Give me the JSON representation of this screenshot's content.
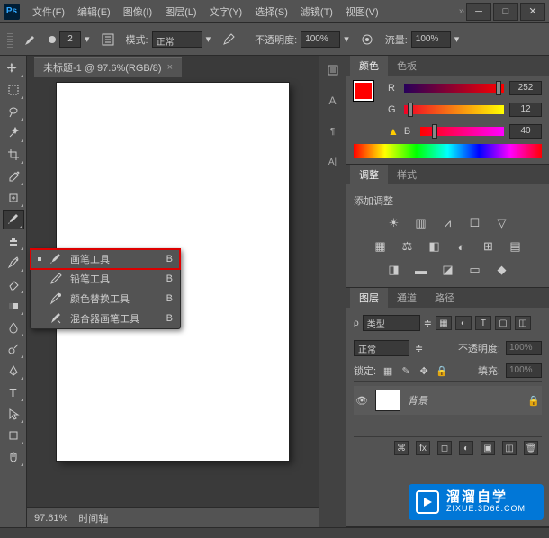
{
  "titlebar": {
    "menus": [
      "文件(F)",
      "编辑(E)",
      "图像(I)",
      "图层(L)",
      "文字(Y)",
      "选择(S)",
      "滤镜(T)",
      "视图(V)"
    ]
  },
  "options": {
    "brush_size": "2",
    "mode_label": "模式:",
    "mode_value": "正常",
    "opacity_label": "不透明度:",
    "opacity_value": "100%",
    "flow_label": "流量:",
    "flow_value": "100%"
  },
  "document": {
    "tab_title": "未标题-1 @ 97.6%(RGB/8)",
    "zoom": "97.61%",
    "timeline": "时间轴"
  },
  "flyout": {
    "items": [
      {
        "label": "画笔工具",
        "shortcut": "B",
        "active": true
      },
      {
        "label": "铅笔工具",
        "shortcut": "B",
        "active": false
      },
      {
        "label": "颜色替换工具",
        "shortcut": "B",
        "active": false
      },
      {
        "label": "混合器画笔工具",
        "shortcut": "B",
        "active": false
      }
    ]
  },
  "color_panel": {
    "tabs": [
      "颜色",
      "色板"
    ],
    "r_label": "R",
    "r_value": "252",
    "g_label": "G",
    "g_value": "12",
    "b_label": "B",
    "b_value": "40"
  },
  "adjust_panel": {
    "tabs": [
      "调整",
      "样式"
    ],
    "add_label": "添加调整"
  },
  "layers_panel": {
    "tabs": [
      "图层",
      "通道",
      "路径"
    ],
    "filter_label": "类型",
    "blend_mode": "正常",
    "opacity_label": "不透明度:",
    "opacity_value": "100%",
    "lock_label": "锁定:",
    "fill_label": "填充:",
    "fill_value": "100%",
    "layer_name": "背景"
  },
  "watermark": {
    "title": "溜溜自学",
    "url": "ZIXUE.3D66.COM"
  }
}
